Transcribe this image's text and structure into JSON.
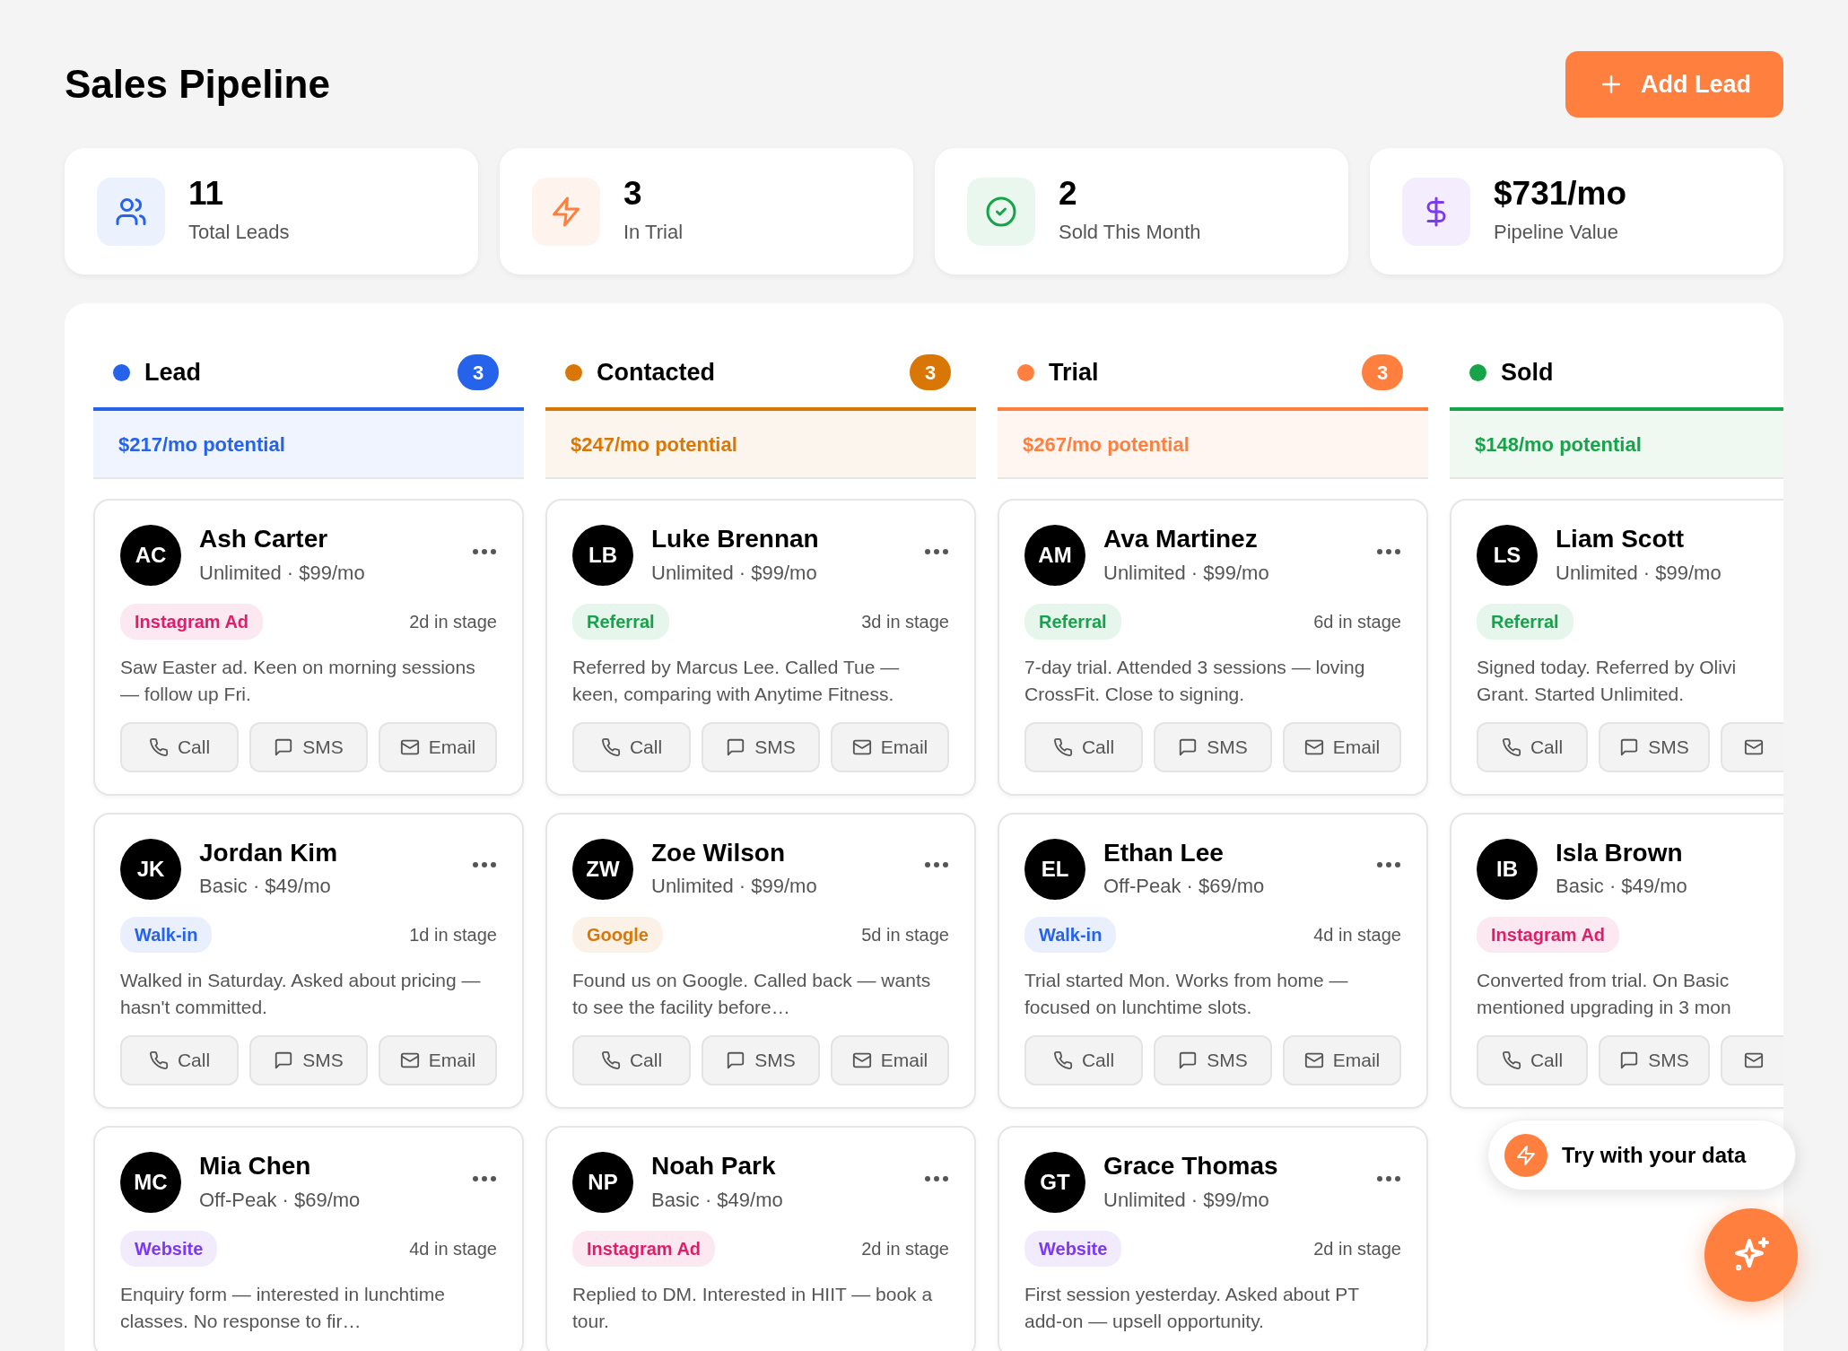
{
  "title": "Sales Pipeline",
  "add_button": {
    "label": "Add Lead"
  },
  "stats": [
    {
      "kind": "users",
      "color": "#2563eb",
      "value": "11",
      "label": "Total Leads"
    },
    {
      "kind": "bolt",
      "color": "#ff7f3f",
      "value": "3",
      "label": "In Trial"
    },
    {
      "kind": "check",
      "color": "#16a34a",
      "value": "2",
      "label": "Sold This Month"
    },
    {
      "kind": "dollar",
      "color": "#7c3aed",
      "value": "$731/mo",
      "label": "Pipeline Value"
    }
  ],
  "columns": [
    {
      "name": "Lead",
      "color": "#2563eb",
      "count": "3",
      "potential": "$217/mo potential",
      "cards": [
        {
          "initials": "AC",
          "name": "Ash Carter",
          "plan": "Unlimited · $99/mo",
          "source": {
            "label": "Instagram Ad",
            "color": "#e11d6a"
          },
          "days": "2d in stage",
          "note": "Saw Easter ad. Keen on morning sessions — follow up Fri.",
          "menu": true,
          "actions": [
            {
              "kind": "call",
              "label": "Call"
            },
            {
              "kind": "sms",
              "label": "SMS"
            },
            {
              "kind": "email",
              "label": "Email"
            }
          ]
        },
        {
          "initials": "JK",
          "name": "Jordan Kim",
          "plan": "Basic · $49/mo",
          "source": {
            "label": "Walk-in",
            "color": "#2563eb"
          },
          "days": "1d in stage",
          "note": "Walked in Saturday. Asked about pricing — hasn't committed.",
          "menu": true,
          "actions": [
            {
              "kind": "call",
              "label": "Call"
            },
            {
              "kind": "sms",
              "label": "SMS"
            },
            {
              "kind": "email",
              "label": "Email"
            }
          ]
        },
        {
          "initials": "MC",
          "name": "Mia Chen",
          "plan": "Off-Peak · $69/mo",
          "source": {
            "label": "Website",
            "color": "#7c3aed"
          },
          "days": "4d in stage",
          "note": "Enquiry form — interested in lunchtime classes. No response to fir…",
          "menu": true
        }
      ]
    },
    {
      "name": "Contacted",
      "color": "#d97706",
      "count": "3",
      "potential": "$247/mo potential",
      "cards": [
        {
          "initials": "LB",
          "name": "Luke Brennan",
          "plan": "Unlimited · $99/mo",
          "source": {
            "label": "Referral",
            "color": "#16a34a"
          },
          "days": "3d in stage",
          "note": "Referred by Marcus Lee. Called Tue — keen, comparing with Anytime Fitness.",
          "menu": true,
          "actions": [
            {
              "kind": "call",
              "label": "Call"
            },
            {
              "kind": "sms",
              "label": "SMS"
            },
            {
              "kind": "email",
              "label": "Email"
            }
          ]
        },
        {
          "initials": "ZW",
          "name": "Zoe Wilson",
          "plan": "Unlimited · $99/mo",
          "source": {
            "label": "Google",
            "color": "#d97706"
          },
          "days": "5d in stage",
          "note": "Found us on Google. Called back — wants to see the facility before…",
          "menu": true,
          "actions": [
            {
              "kind": "call",
              "label": "Call"
            },
            {
              "kind": "sms",
              "label": "SMS"
            },
            {
              "kind": "email",
              "label": "Email"
            }
          ]
        },
        {
          "initials": "NP",
          "name": "Noah Park",
          "plan": "Basic · $49/mo",
          "source": {
            "label": "Instagram Ad",
            "color": "#e11d6a"
          },
          "days": "2d in stage",
          "note": "Replied to DM. Interested in HIIT — book a tour.",
          "menu": true
        }
      ]
    },
    {
      "name": "Trial",
      "color": "#ff7f3f",
      "count": "3",
      "potential": "$267/mo potential",
      "cards": [
        {
          "initials": "AM",
          "name": "Ava Martinez",
          "plan": "Unlimited · $99/mo",
          "source": {
            "label": "Referral",
            "color": "#16a34a"
          },
          "days": "6d in stage",
          "note": "7-day trial. Attended 3 sessions — loving CrossFit. Close to signing.",
          "menu": true,
          "actions": [
            {
              "kind": "call",
              "label": "Call"
            },
            {
              "kind": "sms",
              "label": "SMS"
            },
            {
              "kind": "email",
              "label": "Email"
            }
          ]
        },
        {
          "initials": "EL",
          "name": "Ethan Lee",
          "plan": "Off-Peak · $69/mo",
          "source": {
            "label": "Walk-in",
            "color": "#2563eb"
          },
          "days": "4d in stage",
          "note": "Trial started Mon. Works from home — focused on lunchtime slots.",
          "menu": true,
          "actions": [
            {
              "kind": "call",
              "label": "Call"
            },
            {
              "kind": "sms",
              "label": "SMS"
            },
            {
              "kind": "email",
              "label": "Email"
            }
          ]
        },
        {
          "initials": "GT",
          "name": "Grace Thomas",
          "plan": "Unlimited · $99/mo",
          "source": {
            "label": "Website",
            "color": "#7c3aed"
          },
          "days": "2d in stage",
          "note": "First session yesterday. Asked about PT add-on — upsell opportunity.",
          "menu": true
        }
      ]
    },
    {
      "name": "Sold",
      "color": "#16a34a",
      "potential": "$148/mo potential",
      "cards": [
        {
          "initials": "LS",
          "name": "Liam Scott",
          "plan": "Unlimited · $99/mo",
          "source": {
            "label": "Referral",
            "color": "#16a34a"
          },
          "note": "Signed today. Referred by Olivi\nGrant. Started Unlimited.",
          "menu": false,
          "actions": [
            {
              "kind": "call",
              "label": "Call"
            },
            {
              "kind": "sms",
              "label": "SMS"
            },
            {
              "kind": "email"
            }
          ]
        },
        {
          "initials": "IB",
          "name": "Isla Brown",
          "plan": "Basic · $49/mo",
          "source": {
            "label": "Instagram Ad",
            "color": "#e11d6a"
          },
          "note": "Converted from trial. On Basic\nmentioned upgrading in 3 mon",
          "menu": false,
          "actions": [
            {
              "kind": "call",
              "label": "Call"
            },
            {
              "kind": "sms",
              "label": "SMS"
            },
            {
              "kind": "email"
            }
          ]
        }
      ]
    }
  ],
  "promo": {
    "label": "Try with your data"
  }
}
